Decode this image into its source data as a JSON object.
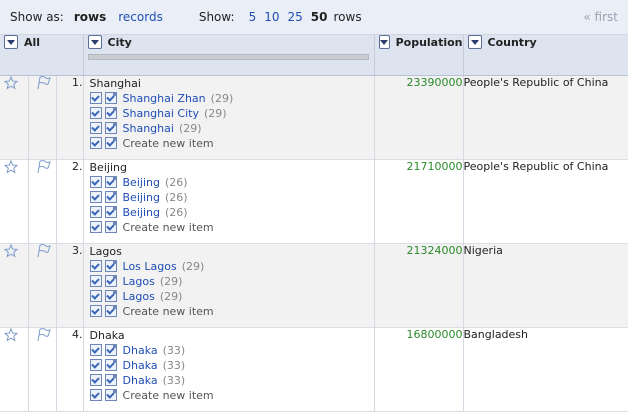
{
  "toolbar": {
    "show_as_label": "Show as:",
    "rows_label": "rows",
    "records_label": "records",
    "show_label": "Show:",
    "page_sizes": [
      "5",
      "10",
      "25",
      "50"
    ],
    "rows_suffix": "rows",
    "first_label": "« first"
  },
  "columns": {
    "all": "All",
    "city": "City",
    "population": "Population",
    "country": "Country"
  },
  "rows": [
    {
      "index": "1.",
      "city": "Shanghai",
      "candidates": [
        {
          "name": "Shanghai Zhan",
          "score": "(29)"
        },
        {
          "name": "Shanghai City",
          "score": "(29)"
        },
        {
          "name": "Shanghai",
          "score": "(29)"
        }
      ],
      "new_item": "Create new item",
      "population": "23390000",
      "country": "People's Republic of China"
    },
    {
      "index": "2.",
      "city": "Beijing",
      "candidates": [
        {
          "name": "Beijing",
          "score": "(26)"
        },
        {
          "name": "Beijing",
          "score": "(26)"
        },
        {
          "name": "Beijing",
          "score": "(26)"
        }
      ],
      "new_item": "Create new item",
      "population": "21710000",
      "country": "People's Republic of China"
    },
    {
      "index": "3.",
      "city": "Lagos",
      "candidates": [
        {
          "name": "Los Lagos",
          "score": "(29)"
        },
        {
          "name": "Lagos",
          "score": "(29)"
        },
        {
          "name": "Lagos",
          "score": "(29)"
        }
      ],
      "new_item": "Create new item",
      "population": "21324000",
      "country": "Nigeria"
    },
    {
      "index": "4.",
      "city": "Dhaka",
      "candidates": [
        {
          "name": "Dhaka",
          "score": "(33)"
        },
        {
          "name": "Dhaka",
          "score": "(33)"
        },
        {
          "name": "Dhaka",
          "score": "(33)"
        }
      ],
      "new_item": "Create new item",
      "population": "16800000",
      "country": "Bangladesh"
    }
  ],
  "colors": {
    "link": "#1f4fb5",
    "population": "#2b8a2b",
    "header_bg": "#dde4f0",
    "odd_row_bg": "#f2f2f2"
  },
  "icons": [
    "star-icon",
    "flag-icon",
    "dropdown-arrow-icon",
    "match-checkbox-icon"
  ]
}
